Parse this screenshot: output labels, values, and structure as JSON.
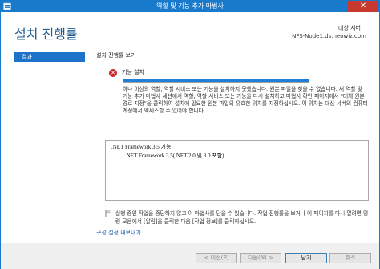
{
  "window": {
    "title": "역할 및 기능 추가 마법사",
    "close_glyph": "✕"
  },
  "header": {
    "page_title": "설치 진행률",
    "destination_label": "대상 서버",
    "destination_server": "NFS-Node1.ds.neowiz.com"
  },
  "sidebar": {
    "items": [
      {
        "label": "결과",
        "selected": true
      }
    ]
  },
  "main": {
    "section_title": "설치 진행률 보기",
    "status": {
      "icon": "error-icon",
      "icon_glyph": "✕",
      "label": "기능 설치",
      "progress_fraction": 0.999
    },
    "error_message": "하나 이상의 역할, 역할 서비스 또는 기능을 설치하지 못했습니다. 원본 파일을 찾을 수 없습니다. 새 역할 및 기능 추가 마법사 세션에서 역할, 역할 서비스 또는 기능을 다시 설치하고 마법사 확인 페이지에서 \"대체 원본 경로 지정\"을 클릭하여 설치에 필요한 원본 파일의 유효한 위치를 지정하십시오. 이 위치는 대상 서버의 컴퓨터 계정에서 액세스할 수 있어야 합니다.",
    "features": [
      ".NET Framework 3.5 기능",
      ".NET Framework 3.5(.NET 2.0 및 3.0 포함)"
    ],
    "note": "실행 중인 작업을 중단하지 않고 이 마법사를 닫을 수 있습니다. 작업 진행률을 보거나 이 페이지를 다시 열려면 명령 모음에서 [알림]을 클릭한 다음 [작업 정보]를 클릭하십시오.",
    "export_link": "구성 설정 내보내기"
  },
  "footer": {
    "prev_label": "< 이전(P)",
    "next_label": "다음(N) >",
    "close_label": "닫기",
    "cancel_label": "취소"
  },
  "colors": {
    "accent": "#1979ca",
    "error": "#c8262b",
    "selected_nav": "#1d73c9"
  }
}
